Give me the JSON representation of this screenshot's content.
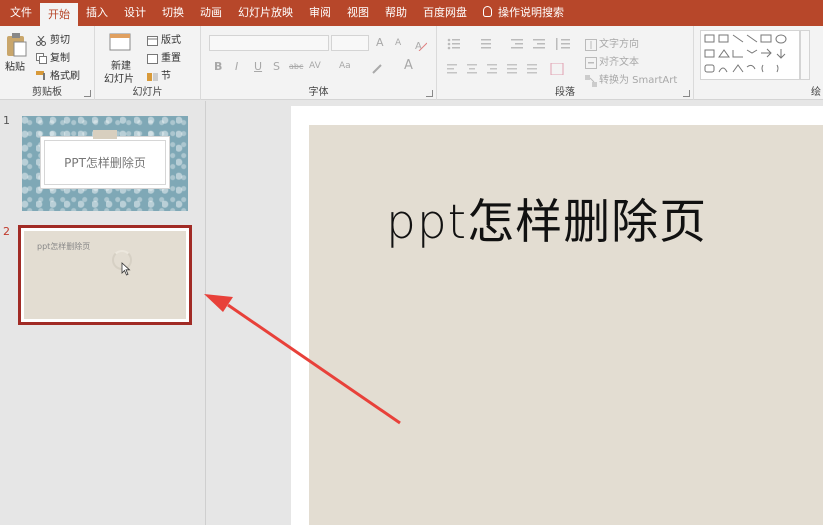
{
  "menu": {
    "items": [
      "文件",
      "开始",
      "插入",
      "设计",
      "切换",
      "动画",
      "幻灯片放映",
      "审阅",
      "视图",
      "帮助",
      "百度网盘"
    ],
    "active_index": 1,
    "tell_me": "操作说明搜索"
  },
  "ribbon": {
    "clipboard": {
      "paste": "粘贴",
      "cut": "剪切",
      "copy": "复制",
      "format_painter": "格式刷",
      "label": "剪贴板"
    },
    "slides": {
      "new_slide_line1": "新建",
      "new_slide_line2": "幻灯片",
      "layout": "版式",
      "reset": "重置",
      "section": "节",
      "label": "幻灯片"
    },
    "font": {
      "label": "字体",
      "bold": "B",
      "italic": "I",
      "underline": "U",
      "shadow": "S",
      "strike": "abc",
      "spacing": "AV",
      "case": "Aa",
      "color": "A",
      "grow": "A",
      "shrink": "A"
    },
    "paragraph": {
      "label": "段落",
      "text_direction": "文字方向",
      "align_text": "对齐文本",
      "smartart": "转换为 SmartArt"
    },
    "drawing": {
      "label": "绘"
    }
  },
  "thumbnails": [
    {
      "number": "1",
      "title": "PPT怎样删除页"
    },
    {
      "number": "2",
      "title": "ppt怎样删除页"
    }
  ],
  "slide": {
    "title": "ppt怎样删除页"
  },
  "colors": {
    "accent": "#b7472a",
    "selection": "#a12b25",
    "slide_bg": "#e3ddd2",
    "arrow": "#e8413a"
  }
}
